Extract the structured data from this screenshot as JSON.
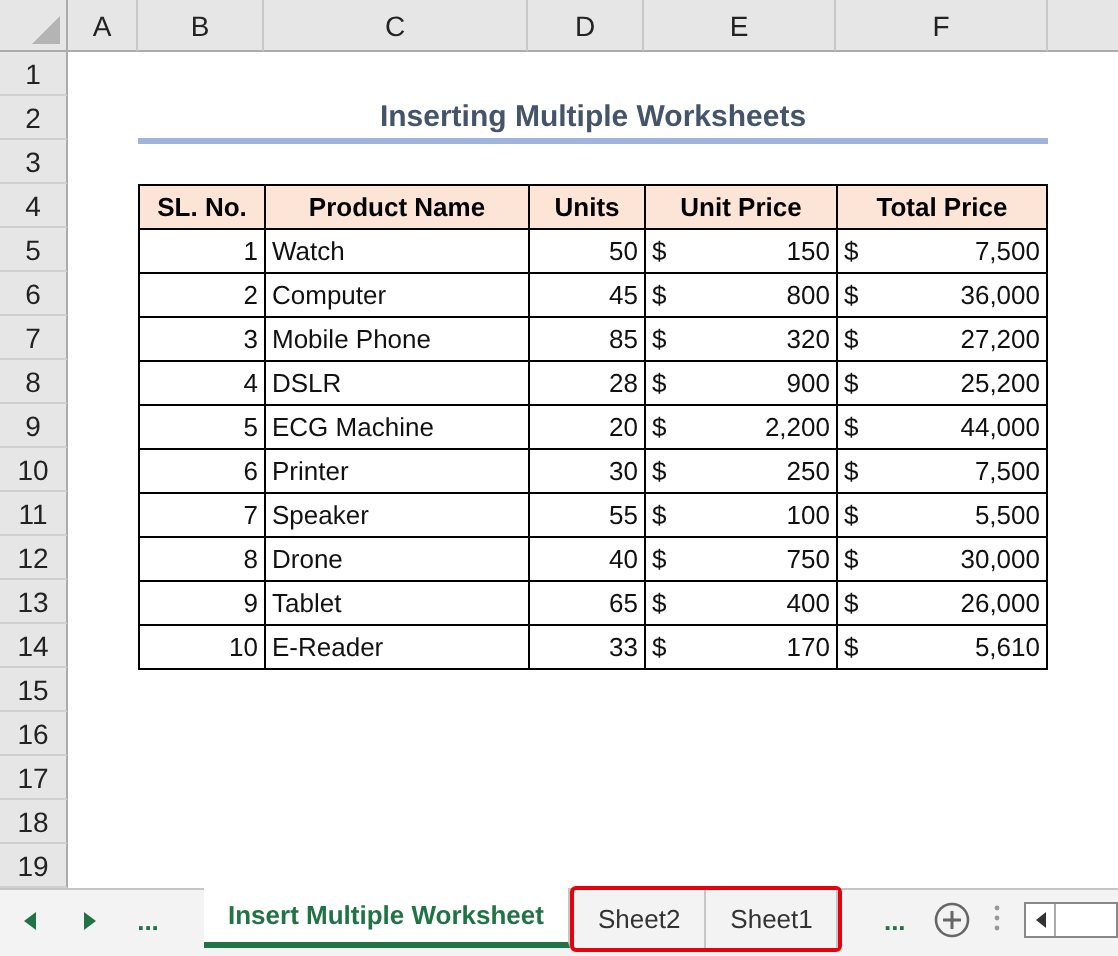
{
  "column_headers": [
    "A",
    "B",
    "C",
    "D",
    "E",
    "F"
  ],
  "row_headers": [
    "1",
    "2",
    "3",
    "4",
    "5",
    "6",
    "7",
    "8",
    "9",
    "10",
    "11",
    "12",
    "13",
    "14",
    "15",
    "16",
    "17",
    "18",
    "19"
  ],
  "title": "Inserting Multiple Worksheets",
  "table": {
    "columns": [
      "SL. No.",
      "Product Name",
      "Units",
      "Unit Price",
      "Total Price"
    ],
    "rows": [
      {
        "sl": "1",
        "product": "Watch",
        "units": "50",
        "unit_price": {
          "symbol": "$",
          "amount": "150"
        },
        "total_price": {
          "symbol": "$",
          "amount": "7,500"
        }
      },
      {
        "sl": "2",
        "product": "Computer",
        "units": "45",
        "unit_price": {
          "symbol": "$",
          "amount": "800"
        },
        "total_price": {
          "symbol": "$",
          "amount": "36,000"
        }
      },
      {
        "sl": "3",
        "product": "Mobile Phone",
        "units": "85",
        "unit_price": {
          "symbol": "$",
          "amount": "320"
        },
        "total_price": {
          "symbol": "$",
          "amount": "27,200"
        }
      },
      {
        "sl": "4",
        "product": "DSLR",
        "units": "28",
        "unit_price": {
          "symbol": "$",
          "amount": "900"
        },
        "total_price": {
          "symbol": "$",
          "amount": "25,200"
        }
      },
      {
        "sl": "5",
        "product": "ECG Machine",
        "units": "20",
        "unit_price": {
          "symbol": "$",
          "amount": "2,200"
        },
        "total_price": {
          "symbol": "$",
          "amount": "44,000"
        }
      },
      {
        "sl": "6",
        "product": "Printer",
        "units": "30",
        "unit_price": {
          "symbol": "$",
          "amount": "250"
        },
        "total_price": {
          "symbol": "$",
          "amount": "7,500"
        }
      },
      {
        "sl": "7",
        "product": "Speaker",
        "units": "55",
        "unit_price": {
          "symbol": "$",
          "amount": "100"
        },
        "total_price": {
          "symbol": "$",
          "amount": "5,500"
        }
      },
      {
        "sl": "8",
        "product": "Drone",
        "units": "40",
        "unit_price": {
          "symbol": "$",
          "amount": "750"
        },
        "total_price": {
          "symbol": "$",
          "amount": "30,000"
        }
      },
      {
        "sl": "9",
        "product": "Tablet",
        "units": "65",
        "unit_price": {
          "symbol": "$",
          "amount": "400"
        },
        "total_price": {
          "symbol": "$",
          "amount": "26,000"
        }
      },
      {
        "sl": "10",
        "product": "E-Reader",
        "units": "33",
        "unit_price": {
          "symbol": "$",
          "amount": "170"
        },
        "total_price": {
          "symbol": "$",
          "amount": "5,610"
        }
      }
    ]
  },
  "sheet_tabs": {
    "left_more": "...",
    "tabs": [
      {
        "label": "Insert Multiple Worksheet",
        "selected": true,
        "highlighted": false
      },
      {
        "label": "Sheet2",
        "selected": false,
        "highlighted": true
      },
      {
        "label": "Sheet1",
        "selected": false,
        "highlighted": true
      }
    ],
    "right_more": "..."
  }
}
